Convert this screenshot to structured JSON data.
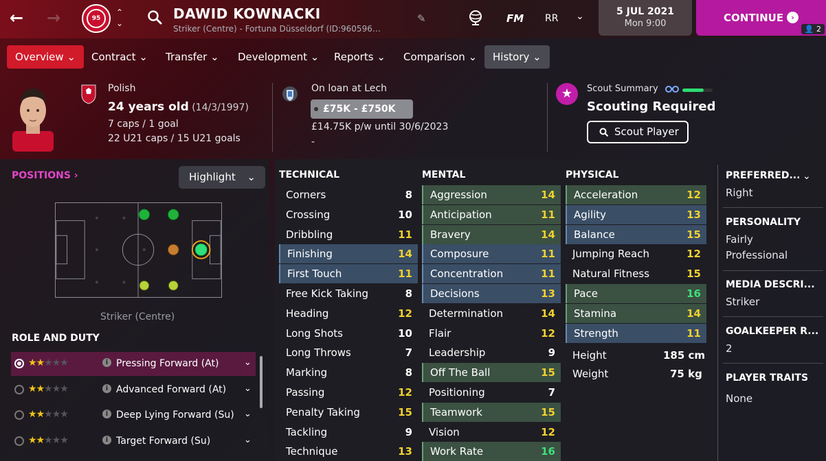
{
  "header": {
    "player_name": "DAWID KOWNACKI",
    "subtitle": "Striker (Centre) - Fortuna Düsseldorf (ID:960596…",
    "club_badge": "95",
    "fm_label": "FM",
    "rr_label": "RR",
    "date": "5 JUL 2021",
    "time": "Mon 9:00",
    "continue_label": "CONTINUE",
    "continue_badge": "2",
    "accent_color": "#b5199f"
  },
  "tabs": [
    {
      "label": "Overview"
    },
    {
      "label": "Contract"
    },
    {
      "label": "Transfer"
    },
    {
      "label": "Development"
    },
    {
      "label": "Reports"
    },
    {
      "label": "Comparison"
    },
    {
      "label": "History"
    }
  ],
  "info": {
    "nationality": "Polish",
    "age": "24 years old",
    "dob": "(14/3/1997)",
    "caps": "7 caps / 1 goal",
    "u21_caps": "22 U21 caps / 15 U21 goals",
    "loan": "On loan at Lech",
    "value_range": "£75K - £750K",
    "wage": "£14.75K p/w until 30/6/2023",
    "dash": "-",
    "scout_summary_label": "Scout Summary",
    "scout_status": "Scouting Required",
    "scout_button": "Scout Player",
    "scout_bar_fraction": 0.7
  },
  "positions": {
    "title": "POSITIONS",
    "highlight_label": "Highlight",
    "position_label": "Striker (Centre)"
  },
  "roles": {
    "title": "ROLE AND DUTY",
    "items": [
      {
        "label": "Pressing Forward (At)",
        "stars": 2,
        "selected": true
      },
      {
        "label": "Advanced Forward (At)",
        "stars": 2,
        "selected": false
      },
      {
        "label": "Deep Lying Forward (Su)",
        "stars": 2,
        "selected": false
      },
      {
        "label": "Target Forward (Su)",
        "stars": 2,
        "selected": false
      }
    ]
  },
  "attributes": {
    "technical_title": "TECHNICAL",
    "mental_title": "MENTAL",
    "physical_title": "PHYSICAL",
    "technical": [
      {
        "name": "Corners",
        "value": "8",
        "hl": ""
      },
      {
        "name": "Crossing",
        "value": "10",
        "hl": ""
      },
      {
        "name": "Dribbling",
        "value": "11",
        "hl": ""
      },
      {
        "name": "Finishing",
        "value": "14",
        "hl": "blue"
      },
      {
        "name": "First Touch",
        "value": "11",
        "hl": "blue"
      },
      {
        "name": "Free Kick Taking",
        "value": "8",
        "hl": ""
      },
      {
        "name": "Heading",
        "value": "12",
        "hl": ""
      },
      {
        "name": "Long Shots",
        "value": "10",
        "hl": ""
      },
      {
        "name": "Long Throws",
        "value": "7",
        "hl": ""
      },
      {
        "name": "Marking",
        "value": "8",
        "hl": ""
      },
      {
        "name": "Passing",
        "value": "12",
        "hl": ""
      },
      {
        "name": "Penalty Taking",
        "value": "15",
        "hl": ""
      },
      {
        "name": "Tackling",
        "value": "9",
        "hl": ""
      },
      {
        "name": "Technique",
        "value": "13",
        "hl": ""
      }
    ],
    "mental": [
      {
        "name": "Aggression",
        "value": "14",
        "hl": "green"
      },
      {
        "name": "Anticipation",
        "value": "11",
        "hl": "green"
      },
      {
        "name": "Bravery",
        "value": "14",
        "hl": "green"
      },
      {
        "name": "Composure",
        "value": "11",
        "hl": "blue"
      },
      {
        "name": "Concentration",
        "value": "11",
        "hl": "blue"
      },
      {
        "name": "Decisions",
        "value": "13",
        "hl": "blue"
      },
      {
        "name": "Determination",
        "value": "14",
        "hl": ""
      },
      {
        "name": "Flair",
        "value": "12",
        "hl": ""
      },
      {
        "name": "Leadership",
        "value": "9",
        "hl": ""
      },
      {
        "name": "Off The Ball",
        "value": "15",
        "hl": "green"
      },
      {
        "name": "Positioning",
        "value": "7",
        "hl": ""
      },
      {
        "name": "Teamwork",
        "value": "15",
        "hl": "green"
      },
      {
        "name": "Vision",
        "value": "12",
        "hl": ""
      },
      {
        "name": "Work Rate",
        "value": "16",
        "hl": "green"
      }
    ],
    "physical": [
      {
        "name": "Acceleration",
        "value": "12",
        "hl": "green"
      },
      {
        "name": "Agility",
        "value": "13",
        "hl": "blue"
      },
      {
        "name": "Balance",
        "value": "15",
        "hl": "blue"
      },
      {
        "name": "Jumping Reach",
        "value": "12",
        "hl": ""
      },
      {
        "name": "Natural Fitness",
        "value": "15",
        "hl": ""
      },
      {
        "name": "Pace",
        "value": "16",
        "hl": "green"
      },
      {
        "name": "Stamina",
        "value": "14",
        "hl": "green"
      },
      {
        "name": "Strength",
        "value": "11",
        "hl": "blue"
      }
    ],
    "height_label": "Height",
    "height_value": "185 cm",
    "weight_label": "Weight",
    "weight_value": "75 kg"
  },
  "sidebar": {
    "preferred_title": "PREFERRED...",
    "preferred_value": "Right",
    "personality_title": "PERSONALITY",
    "personality_value_1": "Fairly",
    "personality_value_2": "Professional",
    "media_title": "MEDIA DESCRI...",
    "media_value": "Striker",
    "gk_title": "GOALKEEPER R...",
    "gk_value": "2",
    "traits_title": "PLAYER TRAITS",
    "traits_value": "None"
  }
}
